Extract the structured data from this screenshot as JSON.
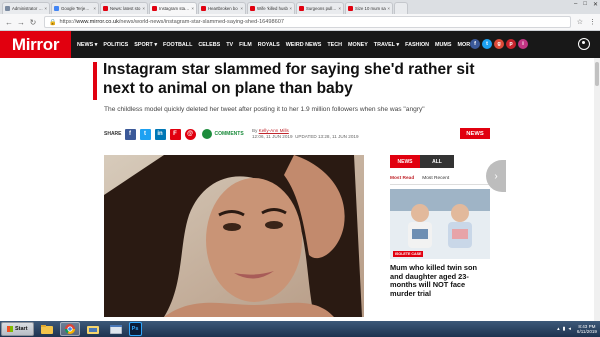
{
  "browser": {
    "tabs": [
      {
        "label": "Administrator Ev",
        "favicon_color": "#7a8aa0"
      },
      {
        "label": "Google Terjemah",
        "favicon_color": "#4285f4"
      },
      {
        "label": "News: latest sto",
        "favicon_color": "#e1000f"
      },
      {
        "label": "Instagram star sl",
        "favicon_color": "#e1000f",
        "active": true
      },
      {
        "label": "Heartbroken bo",
        "favicon_color": "#e1000f"
      },
      {
        "label": "Wife 'killed husb",
        "favicon_color": "#e1000f"
      },
      {
        "label": "Surgeons pull do",
        "favicon_color": "#e1000f"
      },
      {
        "label": "Size 10 mum sa",
        "favicon_color": "#e1000f"
      }
    ],
    "url_prefix": "https://",
    "url_domain": "www.mirror.co.uk",
    "url_path": "/news/world-news/instagram-star-slammed-saying-shed-16498607"
  },
  "site": {
    "logo": "Mirror",
    "nav": [
      "NEWS ▾",
      "POLITICS",
      "SPORT ▾",
      "FOOTBALL",
      "CELEBS",
      "TV",
      "FILM",
      "ROYALS",
      "WEIRD NEWS",
      "TECH",
      "MONEY",
      "TRAVEL ▾",
      "FASHION",
      "MUMS",
      "MORE ▾"
    ],
    "social": [
      {
        "icon": "f",
        "color": "#3b5998"
      },
      {
        "icon": "t",
        "color": "#1da1f2"
      },
      {
        "icon": "g",
        "color": "#dd4b39"
      },
      {
        "icon": "p",
        "color": "#c8232c"
      },
      {
        "icon": "i",
        "color": "#c13584"
      }
    ]
  },
  "article": {
    "headline": "Instagram star slammed for saying she'd rather sit next to animal on plane than baby",
    "standfirst": "The childless model quickly deleted her tweet after posting it to her 1.9 million followers when she was \"angry\"",
    "share_label": "SHARE",
    "comments_label": "COMMENTS",
    "byline_prefix": "By",
    "author": "Kelly-Ann Mills",
    "published": "12:06, 11 JUN 2019",
    "updated": "UPDATED 13:28, 11 JUN 2019",
    "section_badge": "NEWS"
  },
  "sidebar": {
    "tab_news": "NEWS",
    "tab_all": "ALL",
    "sub_most_read": "Most Read",
    "sub_most_recent": "Most Recent",
    "kicker": "ISOLETE CASE",
    "headline": "Mum who killed twin son and daughter aged 23-months will NOT face murder trial"
  },
  "taskbar": {
    "start_label": "Start",
    "apps": [
      "folder",
      "chrome",
      "explorer",
      "window",
      "photoshop"
    ],
    "time": "8:43 PM",
    "date": "6/11/2019"
  }
}
